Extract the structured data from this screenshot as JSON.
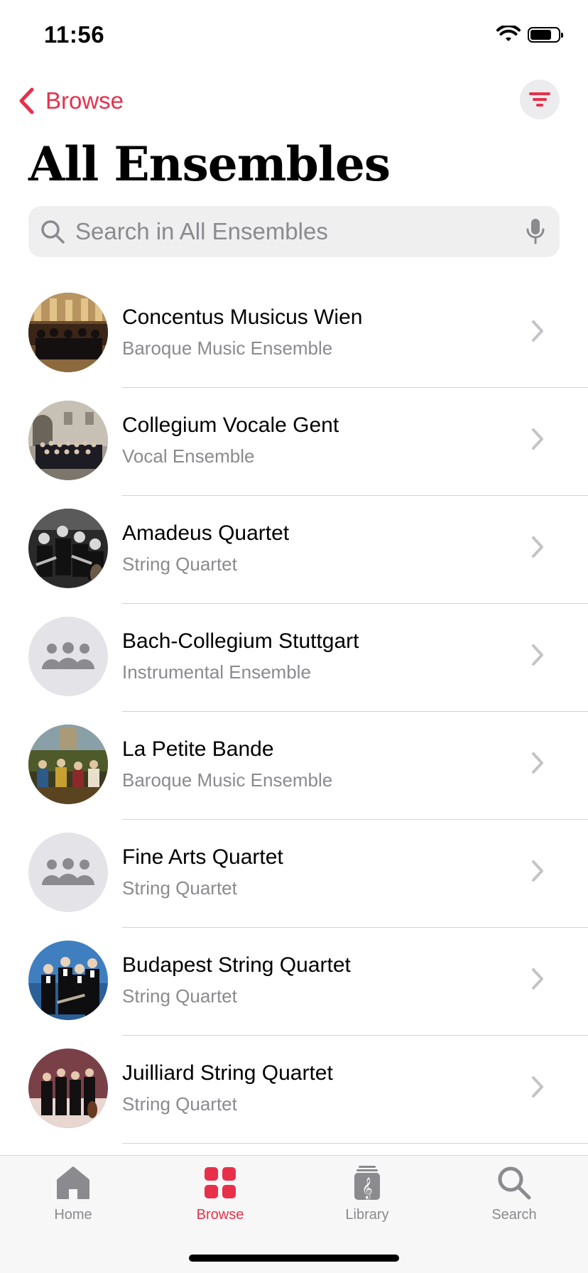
{
  "status_bar": {
    "time": "11:56",
    "battery_level": 0.75
  },
  "nav": {
    "back_label": "Browse"
  },
  "page": {
    "title": "All Ensembles"
  },
  "search": {
    "placeholder": "Search in All Ensembles",
    "value": ""
  },
  "colors": {
    "accent": "#e8304a",
    "secondary_text": "#8a8a8f",
    "divider": "#d2d2d6"
  },
  "ensembles": [
    {
      "name": "Concentus Musicus Wien",
      "type": "Baroque Music Ensemble",
      "image": "orchestra-photo"
    },
    {
      "name": "Collegium Vocale Gent",
      "type": "Vocal Ensemble",
      "image": "choir-photo"
    },
    {
      "name": "Amadeus Quartet",
      "type": "String Quartet",
      "image": "bw-quartet-photo"
    },
    {
      "name": "Bach-Collegium Stuttgart",
      "type": "Instrumental Ensemble",
      "image": "group-placeholder-icon"
    },
    {
      "name": "La Petite Bande",
      "type": "Baroque Music Ensemble",
      "image": "painting-photo"
    },
    {
      "name": "Fine Arts Quartet",
      "type": "String Quartet",
      "image": "group-placeholder-icon"
    },
    {
      "name": "Budapest String Quartet",
      "type": "String Quartet",
      "image": "quartet-photo"
    },
    {
      "name": "Juilliard String Quartet",
      "type": "String Quartet",
      "image": "quartet-photo"
    }
  ],
  "tabs": [
    {
      "label": "Home",
      "icon": "house-icon",
      "active": false
    },
    {
      "label": "Browse",
      "icon": "grid-icon",
      "active": true
    },
    {
      "label": "Library",
      "icon": "library-icon",
      "active": false
    },
    {
      "label": "Search",
      "icon": "search-icon",
      "active": false
    }
  ]
}
